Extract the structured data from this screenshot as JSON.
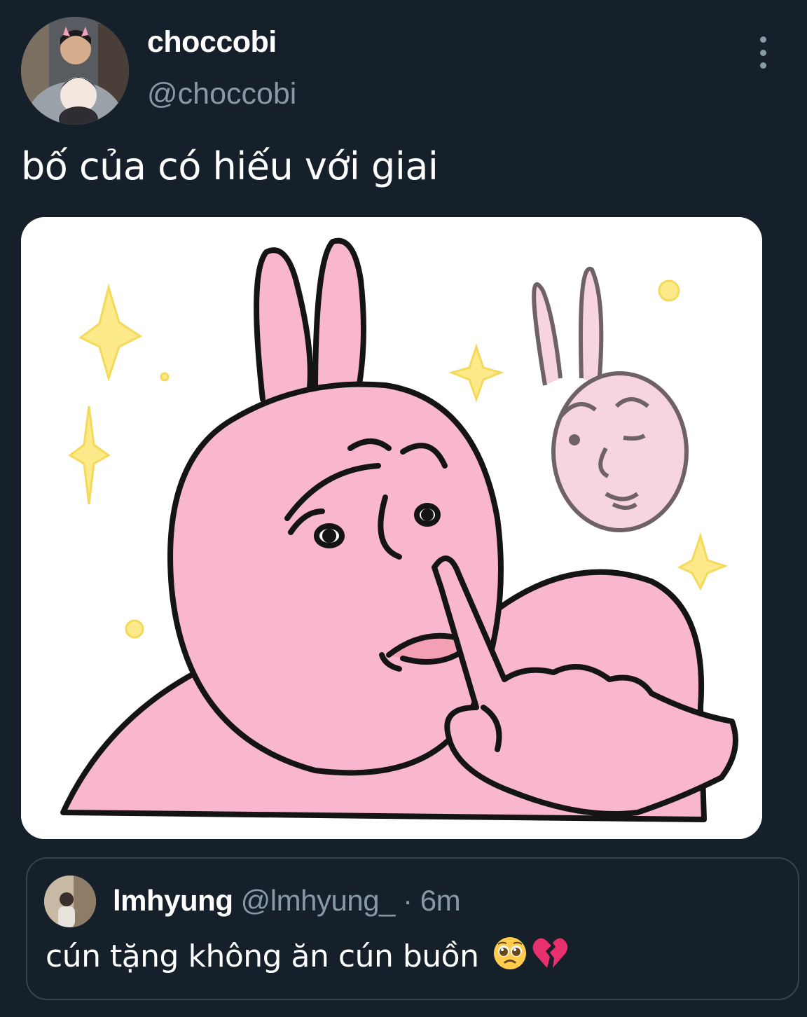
{
  "tweet": {
    "author": {
      "display_name": "choccobi",
      "handle": "@choccobi",
      "avatar_icon": "profile-photo"
    },
    "text": "bố của có hiếu với giai",
    "media_icon": "pink-rabbit-sticker",
    "more_icon": "more-vertical-icon"
  },
  "quote": {
    "display_name": "lmhyung",
    "handle": "@lmhyung_",
    "separator": "·",
    "time": "6m",
    "text": "cún tặng không ăn cún buồn",
    "emojis": [
      "pleading-face-icon",
      "broken-heart-icon"
    ]
  },
  "colors": {
    "background": "#15202b",
    "secondary_text": "#8899a6",
    "border": "#38444d",
    "sticker_pink": "#f9b6cf"
  }
}
